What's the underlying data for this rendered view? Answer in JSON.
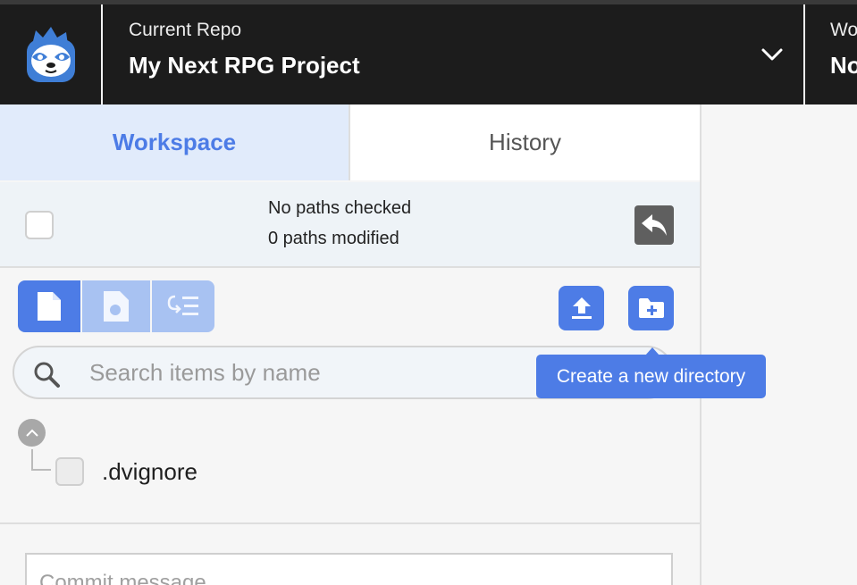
{
  "header": {
    "repo_caption": "Current Repo",
    "repo_name": "My Next RPG Project",
    "workspace_caption": "Wo",
    "workspace_name": "No"
  },
  "tabs": [
    {
      "label": "Workspace",
      "active": true
    },
    {
      "label": "History",
      "active": false
    }
  ],
  "status": {
    "checked_text": "No paths checked",
    "modified_text": "0 paths modified"
  },
  "toolbar": {
    "view_buttons": [
      "file-view-icon",
      "changed-file-view-icon",
      "list-view-icon"
    ],
    "actions": [
      "upload-icon",
      "new-folder-icon"
    ]
  },
  "search": {
    "placeholder": "Search items by name",
    "value": ""
  },
  "tree": {
    "items": [
      {
        "name": ".dvignore",
        "checked": false
      }
    ]
  },
  "commit": {
    "placeholder": "Commit message"
  },
  "tooltip": {
    "text": "Create a new directory"
  },
  "colors": {
    "accent": "#4d7ce6",
    "accent_light": "#a8c2f2",
    "header_bg": "#1c1c1c",
    "tab_active_bg": "#e1ebfb"
  }
}
